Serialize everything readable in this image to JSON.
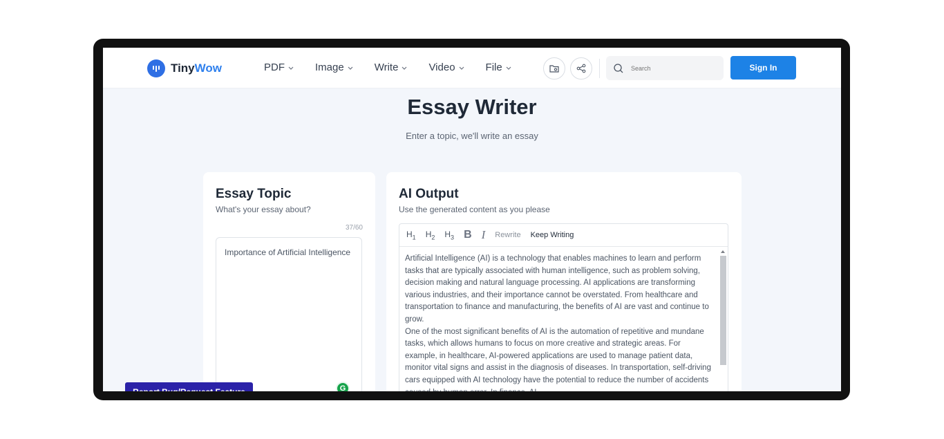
{
  "header": {
    "logo_part1": "Tiny",
    "logo_part2": "Wow",
    "nav": [
      {
        "label": "PDF"
      },
      {
        "label": "Image"
      },
      {
        "label": "Write"
      },
      {
        "label": "Video"
      },
      {
        "label": "File"
      }
    ],
    "search_placeholder": "Search",
    "signin_label": "Sign In"
  },
  "hero": {
    "title": "Essay Writer",
    "subtitle": "Enter a topic, we'll write an essay"
  },
  "topic_card": {
    "title": "Essay Topic",
    "subtitle": "What's your essay about?",
    "counter": "37/60",
    "value": "Importance of Artificial Intelligence"
  },
  "output_card": {
    "title": "AI Output",
    "subtitle": "Use the generated content as you please",
    "toolbar": {
      "h1": "H",
      "h1_sub": "1",
      "h2": "H",
      "h2_sub": "2",
      "h3": "H",
      "h3_sub": "3",
      "bold": "B",
      "italic": "I",
      "rewrite": "Rewrite",
      "keep_writing": "Keep Writing"
    },
    "paragraphs": [
      "Artificial Intelligence (AI) is a technology that enables machines to learn and perform tasks that are typically associated with human intelligence, such as problem solving, decision making and natural language processing. AI applications are transforming various industries, and their importance cannot be overstated. From healthcare and transportation to finance and manufacturing, the benefits of AI are vast and continue to grow.",
      "One of the most significant benefits of AI is the automation of repetitive and mundane tasks, which allows humans to focus on more creative and strategic areas. For example, in healthcare, AI-powered applications are used to manage patient data, monitor vital signs and assist in the diagnosis of diseases. In transportation, self-driving cars equipped with AI technology have the potential to reduce the number of accidents caused by human error. In finance, AI"
    ]
  },
  "report_button": "Report Bug/Request Feature",
  "grammarly_letter": "G",
  "colors": {
    "brand_blue": "#2f80ed",
    "signin_blue": "#1d82e6",
    "report_purple": "#2b22a8"
  }
}
